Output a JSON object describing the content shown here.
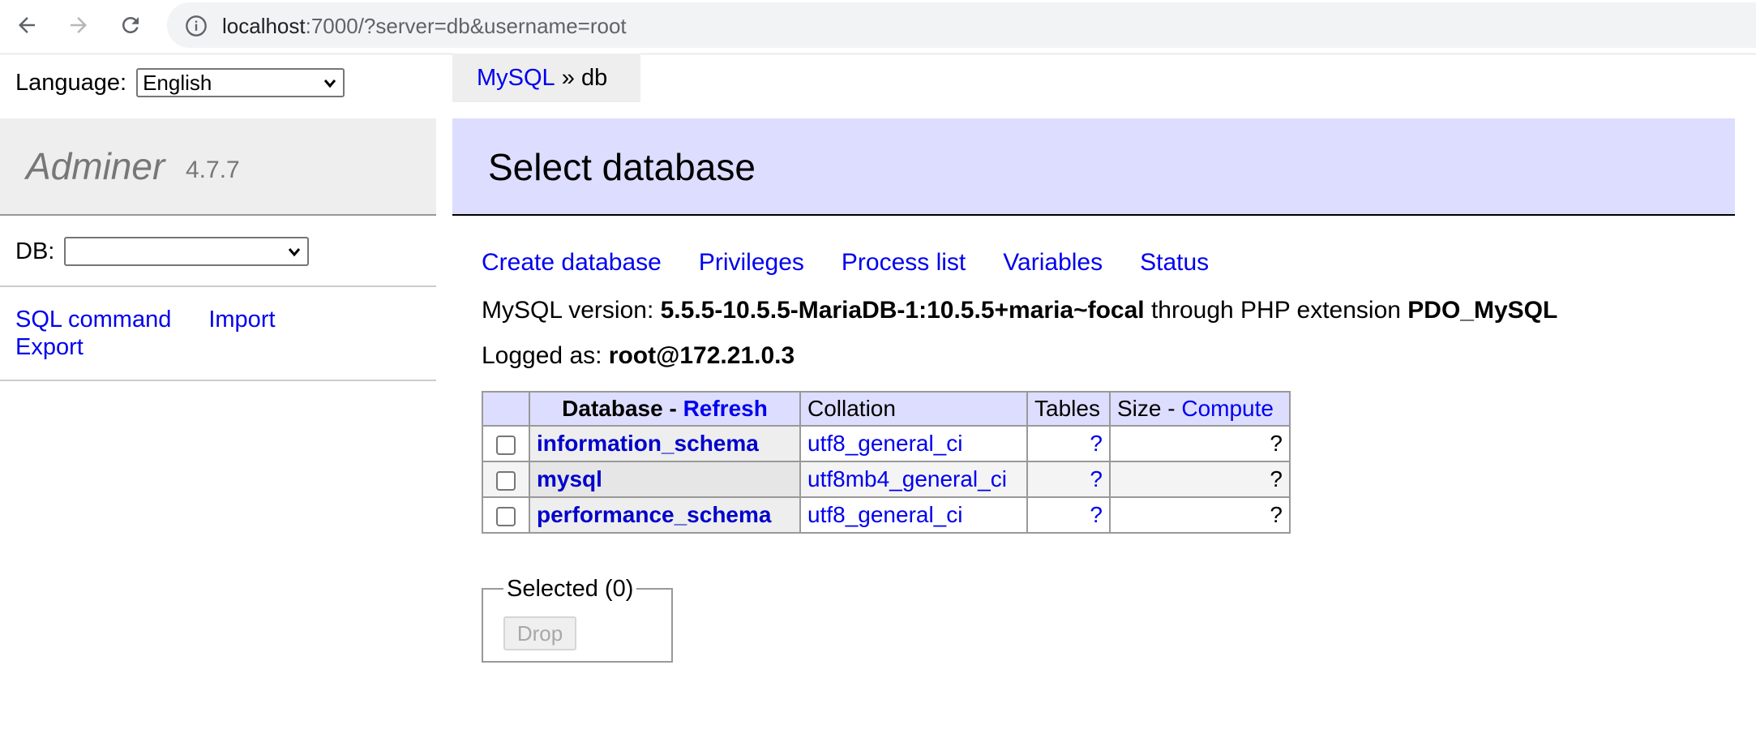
{
  "browser": {
    "url_host": "localhost",
    "url_rest": ":7000/?server=db&username=root",
    "icons": [
      "back-icon",
      "forward-icon",
      "reload-icon",
      "info-icon"
    ]
  },
  "sidebar": {
    "language_label": "Language:",
    "language_value": "English",
    "brand": "Adminer",
    "version": "4.7.7",
    "db_label": "DB:",
    "db_value": "",
    "links": {
      "sql_command": "SQL command",
      "import": "Import",
      "export": "Export"
    }
  },
  "breadcrumb": {
    "root": "MySQL",
    "separator": "»",
    "current": "db"
  },
  "header": {
    "title": "Select database"
  },
  "actions": {
    "create_database": "Create database",
    "privileges": "Privileges",
    "process_list": "Process list",
    "variables": "Variables",
    "status": "Status"
  },
  "info": {
    "version_prefix": "MySQL version: ",
    "version_value": "5.5.5-10.5.5-MariaDB-1:10.5.5+maria~focal",
    "version_middle": " through PHP extension ",
    "extension": "PDO_MySQL",
    "logged_prefix": "Logged as: ",
    "logged_value": "root@172.21.0.3"
  },
  "table": {
    "headers": {
      "database": "Database - ",
      "refresh": "Refresh",
      "collation": "Collation",
      "tables": "Tables",
      "size": "Size - ",
      "compute": "Compute"
    },
    "rows": [
      {
        "name": "information_schema",
        "collation": "utf8_general_ci",
        "tables": "?",
        "size": "?"
      },
      {
        "name": "mysql",
        "collation": "utf8mb4_general_ci",
        "tables": "?",
        "size": "?"
      },
      {
        "name": "performance_schema",
        "collation": "utf8_general_ci",
        "tables": "?",
        "size": "?"
      }
    ]
  },
  "selected": {
    "legend": "Selected (0)",
    "drop_label": "Drop"
  },
  "colors": {
    "link": "#0000ee",
    "header_bg": "#ddddff",
    "sidebar_bg": "#eeeeee"
  }
}
